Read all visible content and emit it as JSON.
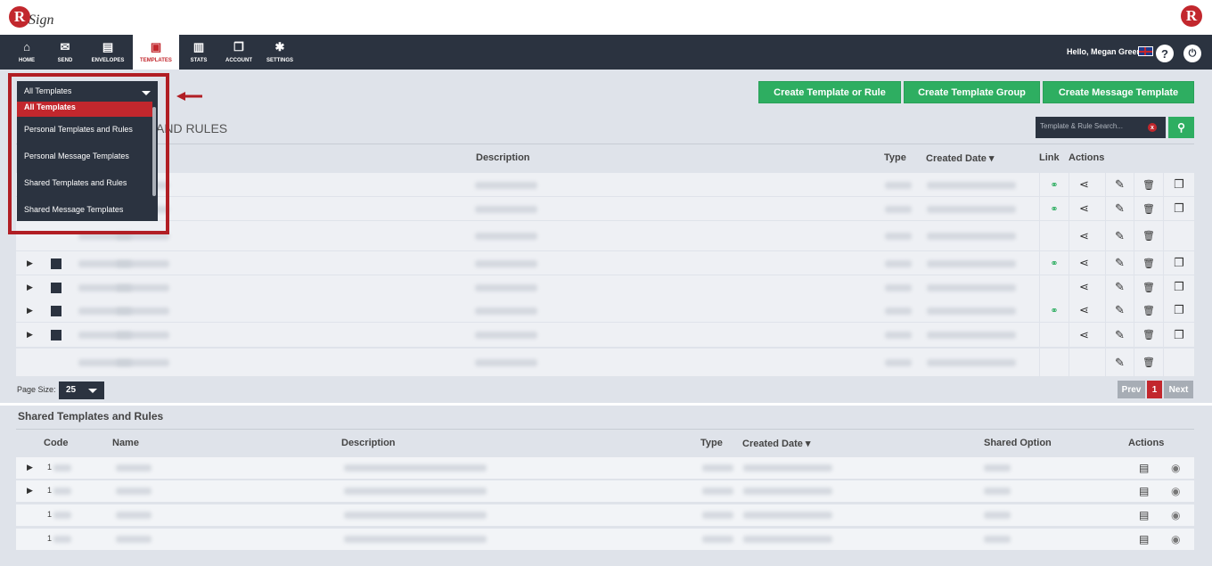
{
  "app": {
    "brand_letter": "R",
    "brand_script": "Sign"
  },
  "nav": {
    "items": [
      {
        "label": "HOME",
        "icon": "home-icon",
        "glyph": "⌂"
      },
      {
        "label": "SEND",
        "icon": "envelope-icon",
        "glyph": "✉"
      },
      {
        "label": "ENVELOPES",
        "icon": "envelopes-icon",
        "glyph": "▤"
      },
      {
        "label": "TEMPLATES",
        "icon": "templates-icon",
        "glyph": "▣"
      },
      {
        "label": "STATS",
        "icon": "briefcase-icon",
        "glyph": "▥"
      },
      {
        "label": "ACCOUNT",
        "icon": "account-icon",
        "glyph": "❐"
      },
      {
        "label": "SETTINGS",
        "icon": "gear-icon",
        "glyph": "✱"
      }
    ],
    "active": "TEMPLATES",
    "greeting": "Hello, Megan Greene",
    "help_glyph": "?",
    "power_glyph": "⏻"
  },
  "toolbar": {
    "create_template_or_rule": "Create Template or Rule",
    "create_template_group": "Create Template Group",
    "create_message_template": "Create Message Template",
    "search_placeholder": "Template & Rule Search...",
    "search_clear": "x",
    "search_glyph": "⚲"
  },
  "filter": {
    "selected": "All Templates",
    "options": [
      "All Templates",
      "Personal Templates and Rules",
      "Personal Message Templates",
      "Shared Templates and Rules",
      "Shared Message Templates"
    ]
  },
  "section1": {
    "title_partial": "AND RULES",
    "headers": {
      "description": "Description",
      "type": "Type",
      "created": "Created Date ▾",
      "link": "Link",
      "actions": "Actions"
    },
    "rows": 8
  },
  "pager": {
    "page_size_label": "Page Size:",
    "page_size": "25",
    "prev": "Prev",
    "page": "1",
    "next": "Next"
  },
  "section2": {
    "title": "Shared Templates and Rules",
    "headers": {
      "code": "Code",
      "name": "Name",
      "description": "Description",
      "type": "Type",
      "created": "Created Date ▾",
      "shared_option": "Shared Option",
      "actions": "Actions"
    },
    "codes": [
      "1",
      "1",
      "1",
      "1"
    ]
  },
  "colors": {
    "accent": "#c2272d",
    "nav_bg": "#2b3340",
    "green": "#2eae61"
  }
}
